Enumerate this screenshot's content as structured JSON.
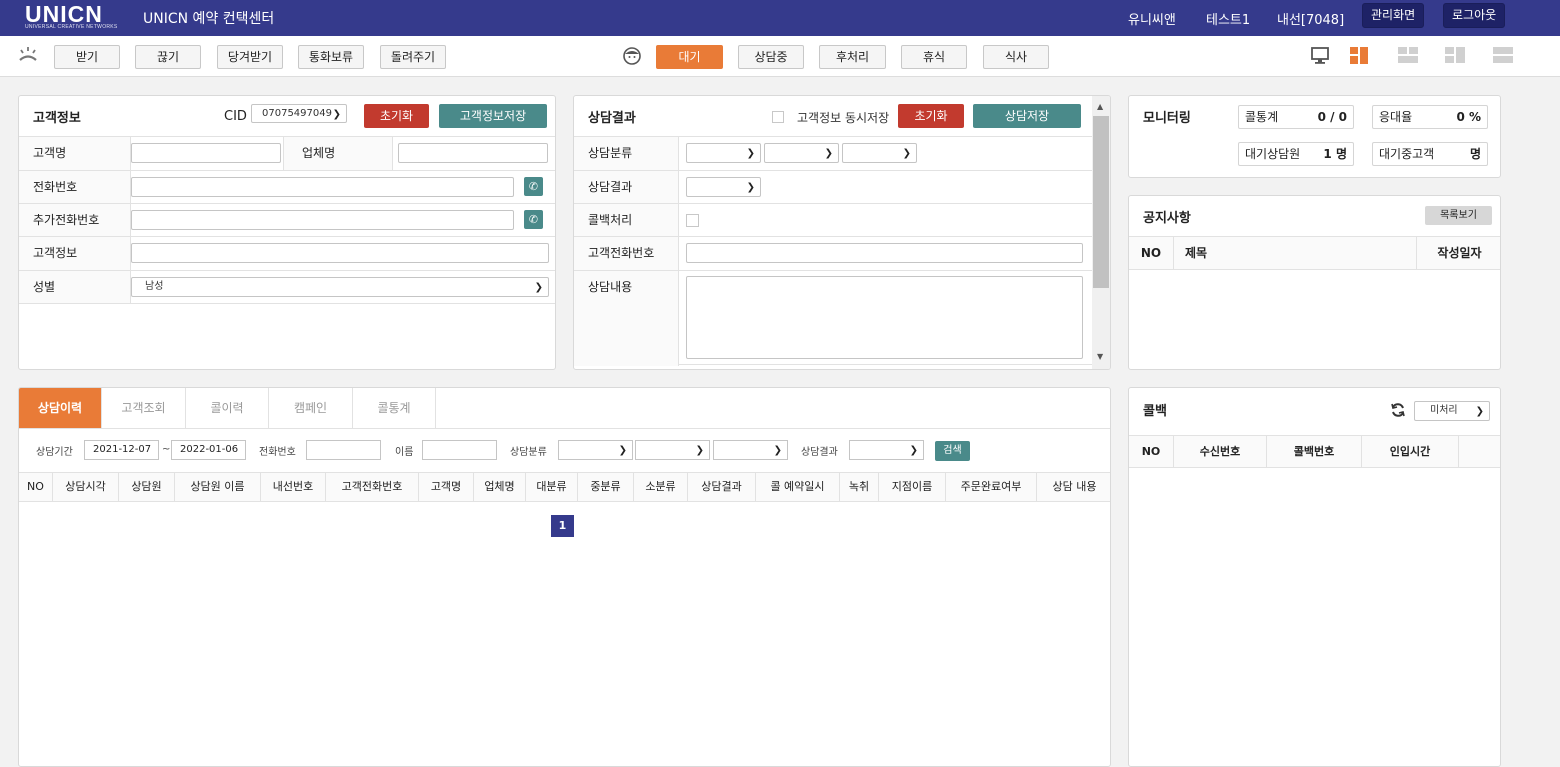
{
  "app": {
    "logo": "UNICN",
    "logo_sub": "UNIVERSAL CREATIVE NETWORKS",
    "title": "UNICN 예약 컨택센터",
    "company": "유니씨앤",
    "user": "테스트1",
    "extension": "내선[7048]",
    "admin_button": "관리화면",
    "logout_button": "로그아웃"
  },
  "toolbar": {
    "call_buttons": [
      "받기",
      "끊기",
      "당겨받기",
      "통화보류",
      "돌려주기"
    ],
    "status_buttons": [
      "대기",
      "상담중",
      "후처리",
      "휴식",
      "식사"
    ],
    "active_status": "대기"
  },
  "customer": {
    "title": "고객정보",
    "cid_label": "CID",
    "cid_value": "07075497049",
    "reset_button": "초기화",
    "save_button": "고객정보저장",
    "labels": {
      "name": "고객명",
      "company": "업체명",
      "phone": "전화번호",
      "extra_phone": "추가전화번호",
      "info": "고객정보",
      "gender": "성별"
    },
    "gender_value": "남성"
  },
  "consult": {
    "title": "상담결과",
    "sync_save_label": "고객정보 동시저장",
    "reset_button": "초기화",
    "save_button": "상담저장",
    "labels": {
      "category": "상담분류",
      "result": "상담결과",
      "callback": "콜백처리",
      "customer_phone": "고객전화번호",
      "content": "상담내용"
    }
  },
  "monitoring": {
    "title": "모니터링",
    "call_stats_label": "콜통계",
    "call_stats_value": "0 / 0",
    "response_rate_label": "응대율",
    "response_rate_value": "0 %",
    "waiting_agents_label": "대기상담원",
    "waiting_agents_value": "1 명",
    "waiting_customers_label": "대기중고객",
    "waiting_customers_value": "명"
  },
  "notice": {
    "title": "공지사항",
    "list_button": "목록보기",
    "columns": [
      "NO",
      "제목",
      "작성일자"
    ]
  },
  "history": {
    "tabs": [
      "상담이력",
      "고객조회",
      "콜이력",
      "캠페인",
      "콜통계"
    ],
    "active_tab": "상담이력",
    "filters": {
      "period_label": "상담기간",
      "date_from": "2021-12-07",
      "date_to": "2022-01-06",
      "tilde": "~",
      "phone_label": "전화번호",
      "name_label": "이름",
      "category_label": "상담분류",
      "result_label": "상담결과",
      "search_button": "검색"
    },
    "columns": [
      "NO",
      "상담시각",
      "상담원",
      "상담원 이름",
      "내선번호",
      "고객전화번호",
      "고객명",
      "업체명",
      "대분류",
      "중분류",
      "소분류",
      "상담결과",
      "콜 예약일시",
      "녹취",
      "지점이름",
      "주문완료여부",
      "상담 내용"
    ],
    "current_page": "1"
  },
  "callback": {
    "title": "콜백",
    "filter_value": "미처리",
    "columns": [
      "NO",
      "수신번호",
      "콜백번호",
      "인입시간"
    ]
  },
  "colors": {
    "topbar": "#353a8c",
    "accent": "#e97b37",
    "red": "#c23a2e",
    "teal": "#4a8a8a"
  }
}
